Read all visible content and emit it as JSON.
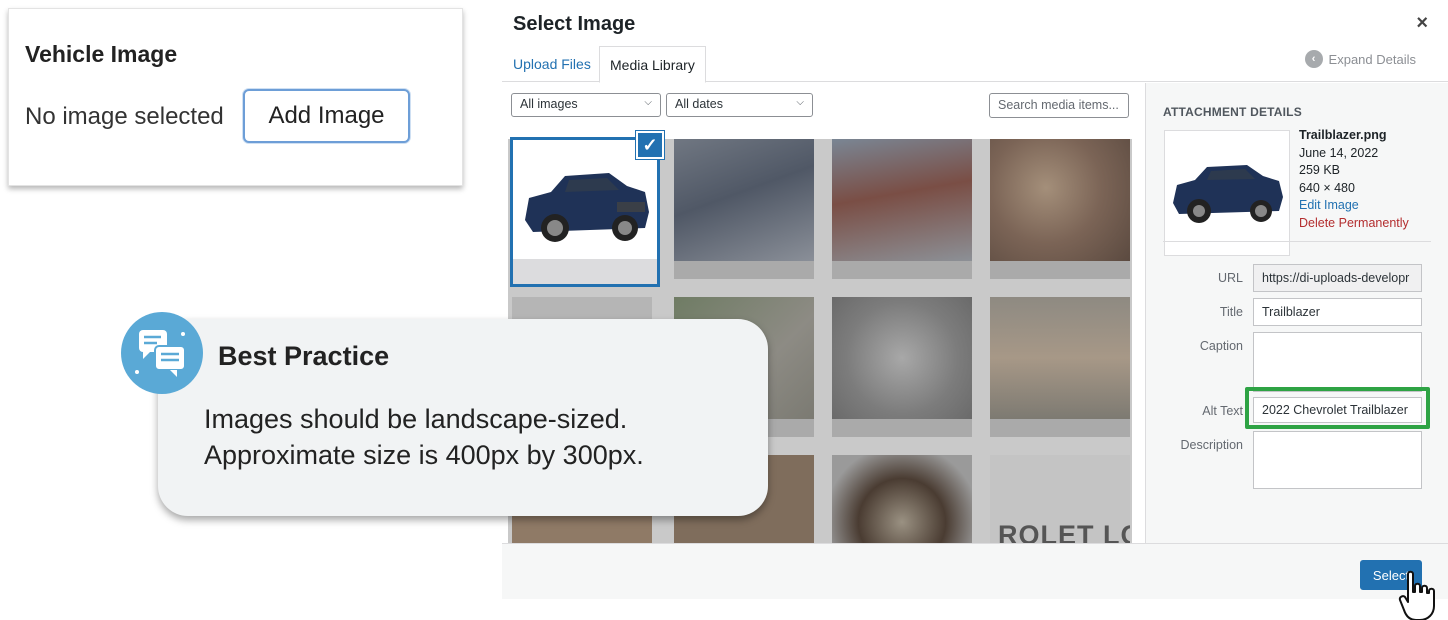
{
  "vehicle_card": {
    "title": "Vehicle Image",
    "status": "No image selected",
    "add_button": "Add Image"
  },
  "modal": {
    "title": "Select Image",
    "close": "×",
    "tabs": [
      {
        "label": "Upload Files",
        "active": false
      },
      {
        "label": "Media Library",
        "active": true
      }
    ],
    "expand_details": "Expand Details",
    "filters": {
      "type": "All images",
      "date": "All dates",
      "search_placeholder": "Search media items..."
    },
    "grid_overlay_text": "ROLET LOGO",
    "details": {
      "heading": "ATTACHMENT DETAILS",
      "filename": "Trailblazer.png",
      "date": "June 14, 2022",
      "size": "259 KB",
      "dimensions": "640 × 480",
      "edit_link": "Edit Image",
      "delete_link": "Delete Permanently",
      "labels": {
        "url": "URL",
        "title": "Title",
        "caption": "Caption",
        "alt": "Alt Text",
        "description": "Description"
      },
      "values": {
        "url": "https://di-uploads-developr",
        "title": "Trailblazer",
        "caption": "",
        "alt": "2022 Chevrolet Trailblazer",
        "description": ""
      }
    },
    "select_button": "Select"
  },
  "callout": {
    "title": "Best Practice",
    "line1": "Images should be landscape-sized.",
    "line2": "Approximate size is 400px by 300px."
  },
  "colors": {
    "accent": "#2271b1",
    "highlight": "#2ea344",
    "delete": "#b32d2e"
  }
}
